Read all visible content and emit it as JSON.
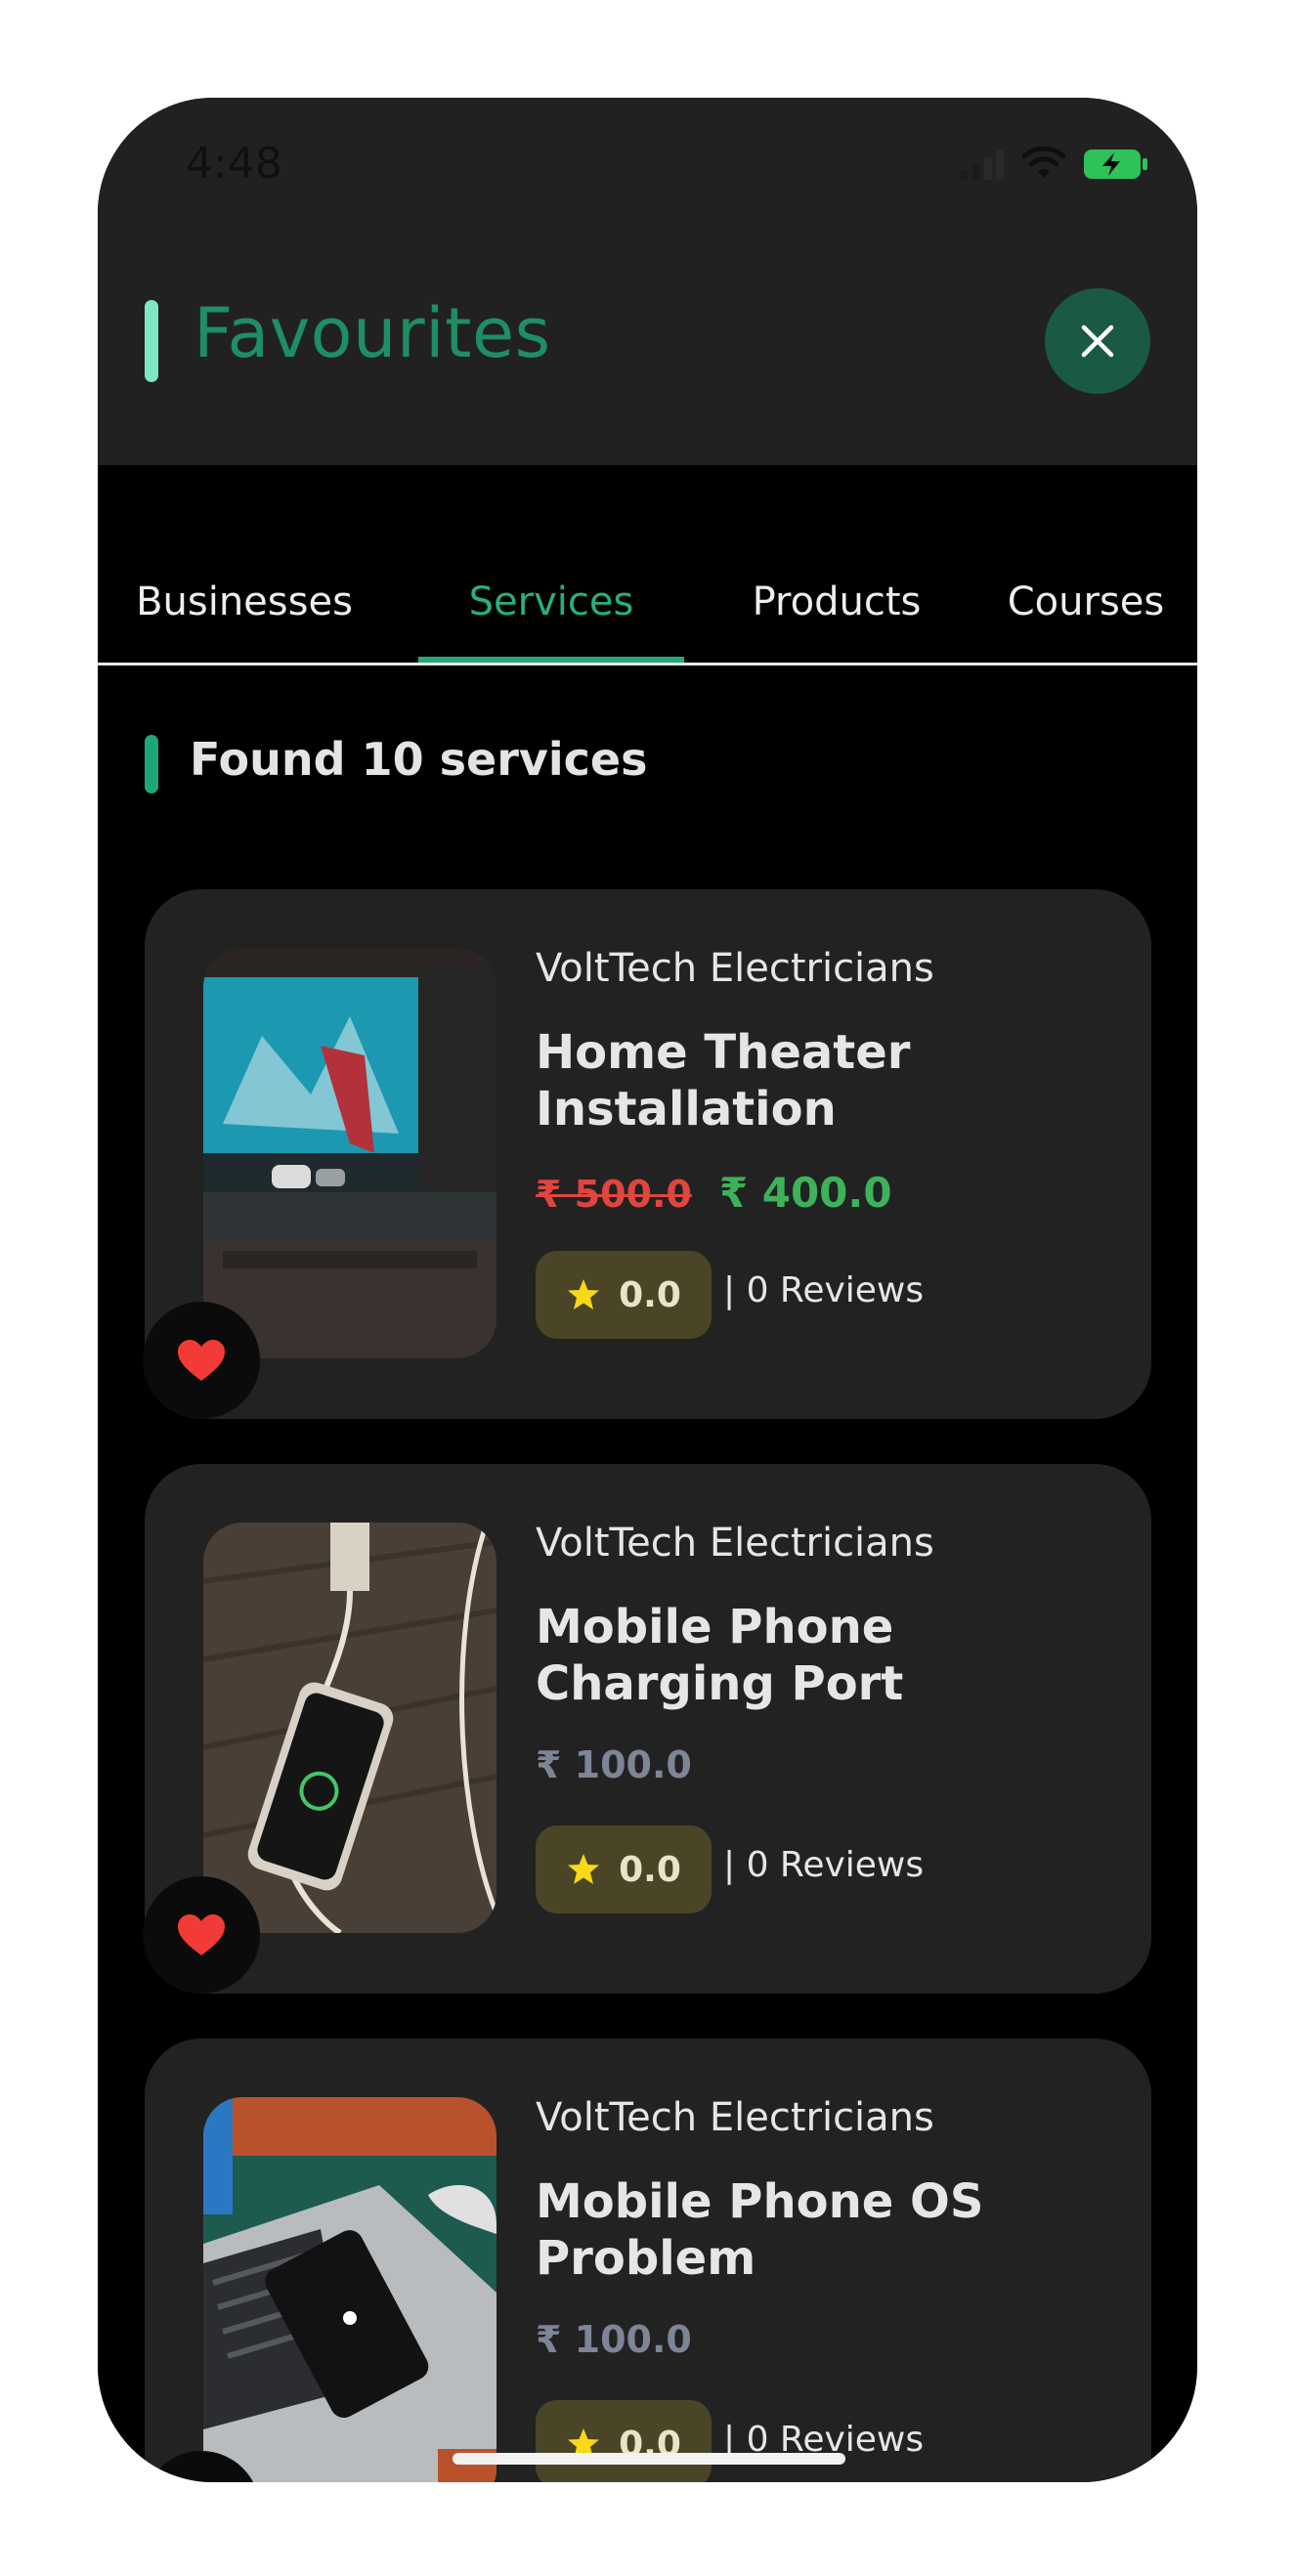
{
  "status_bar": {
    "time": "4:48"
  },
  "header": {
    "title": "Favourites"
  },
  "tabs": [
    {
      "label": "Businesses",
      "active": false
    },
    {
      "label": "Services",
      "active": true
    },
    {
      "label": "Products",
      "active": false
    },
    {
      "label": "Courses",
      "active": false
    }
  ],
  "results": {
    "summary": "Found 10 services"
  },
  "cards": [
    {
      "provider": "VoltTech Electricians",
      "title": "Home Theater Installation",
      "old_price": "₹ 500.0",
      "price": "₹ 400.0",
      "rating": "0.0",
      "reviews": "| 0 Reviews",
      "favourite": true
    },
    {
      "provider": "VoltTech Electricians",
      "title": "Mobile Phone Charging Port",
      "price": "₹ 100.0",
      "rating": "0.0",
      "reviews": "| 0 Reviews",
      "favourite": true
    },
    {
      "provider": "VoltTech Electricians",
      "title": "Mobile Phone OS Problem",
      "price": "₹ 100.0",
      "rating": "0.0",
      "reviews": "| 0 Reviews",
      "favourite": true
    }
  ],
  "colors": {
    "accent": "#27b07c",
    "old_price": "#e0463f",
    "discount_price": "#3eb25a",
    "heart": "#f23b36",
    "star": "#f7d917"
  }
}
